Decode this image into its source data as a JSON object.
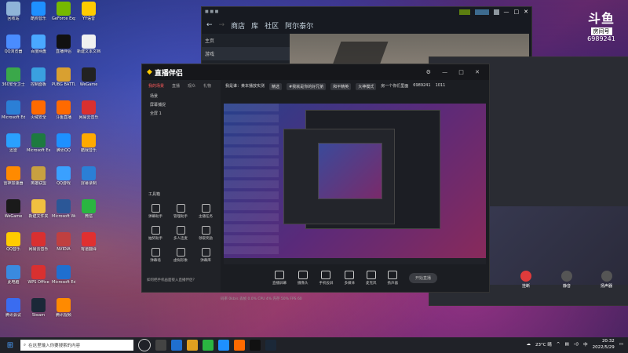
{
  "desktop_icons": [
    {
      "label": "回收站",
      "color": "#8fb4d8"
    },
    {
      "label": "QQ浏览器",
      "color": "#4a8cff"
    },
    {
      "label": "360安全卫士",
      "color": "#3aa84a"
    },
    {
      "label": "Microsoft Edge",
      "color": "#2b7fd6"
    },
    {
      "label": "迅雷",
      "color": "#2aa0ff"
    },
    {
      "label": "雷神加速器",
      "color": "#ff8a00"
    },
    {
      "label": "WeGame",
      "color": "#1a1a1a"
    },
    {
      "label": "QQ音乐",
      "color": "#ffcc00"
    },
    {
      "label": "此电脑",
      "color": "#3a8adf"
    },
    {
      "label": "腾讯会议",
      "color": "#3a6cf0"
    },
    {
      "label": "酷狗音乐",
      "color": "#1e90ff"
    },
    {
      "label": "百度网盘",
      "color": "#4aa8ff"
    },
    {
      "label": "控制面板",
      "color": "#3aa0e0"
    },
    {
      "label": "火绒安全",
      "color": "#ff6a00"
    },
    {
      "label": "Microsoft Excel 2010",
      "color": "#1d7a40"
    },
    {
      "label": "英雄联盟",
      "color": "#c8a040"
    },
    {
      "label": "新建文件夹",
      "color": "#f0c040"
    },
    {
      "label": "网易云音乐",
      "color": "#d93030"
    },
    {
      "label": "WPS Office",
      "color": "#d93030"
    },
    {
      "label": "Steam",
      "color": "#1b2838"
    },
    {
      "label": "GeForce Experience",
      "color": "#76b900"
    },
    {
      "label": "直播伴侣",
      "color": "#111"
    },
    {
      "label": "PUBG BATTLEGROUNDS",
      "color": "#d9a030"
    },
    {
      "label": "斗鱼直播",
      "color": "#ff6a00"
    },
    {
      "label": "腾讯QQ",
      "color": "#1e90ff"
    },
    {
      "label": "QQ游戏",
      "color": "#3aa0ff"
    },
    {
      "label": "Microsoft Word 2010",
      "color": "#2b5797"
    },
    {
      "label": "NVIDIA",
      "color": "#c04040"
    },
    {
      "label": "Microsoft Edge",
      "color": "#1f6fd0"
    },
    {
      "label": "腾讯视频",
      "color": "#ff8a00"
    },
    {
      "label": "YY语音",
      "color": "#ffcc00"
    },
    {
      "label": "新建文本文档",
      "color": "#f0f0f0"
    },
    {
      "label": "WeGame",
      "color": "#222"
    },
    {
      "label": "网易云音乐",
      "color": "#d93030"
    },
    {
      "label": "酷我音乐",
      "color": "#ffaa00"
    },
    {
      "label": "屏幕录制",
      "color": "#2b7fd6"
    },
    {
      "label": "微信",
      "color": "#2ab541"
    },
    {
      "label": "有道翻译",
      "color": "#e03030"
    }
  ],
  "steam": {
    "nav_back": "←",
    "nav_forward": "→",
    "tab_store": "商店",
    "tab_library": "库",
    "tab_community": "社区",
    "user_name": "阿尔泰尔",
    "side_items": [
      "主页",
      "游戏",
      "近期"
    ]
  },
  "brand": {
    "name": "斗鱼",
    "room_label": "房间号",
    "room_id": "6989241"
  },
  "obs": {
    "app_title": "直播伴侣",
    "tabs": [
      "我的场景",
      "直播",
      "观众",
      "礼物"
    ],
    "scene_items": [
      "场景",
      "屏幕捕捉",
      "全屏 1"
    ],
    "tools_title": "工具箱",
    "tools": [
      "弹幕助手",
      "管理助手",
      "主播任务",
      "抽奖助手",
      "多人连麦",
      "领取奖励",
      "弹幕墙",
      "虚拟形象",
      "弹幕库"
    ],
    "stream_title": "我是谁：黄本播放实测",
    "tag1": "精选",
    "tag2": "#我就是你的好兄弟",
    "category": "和平精英",
    "mode": "大神模式",
    "room_line": "房一个你们里面",
    "room_no": "6989241",
    "viewers": "1011",
    "bottom_buttons": [
      "直播屏幕",
      "摄像头",
      "手机投屏",
      "多媒体",
      "麦克风",
      "扬声器"
    ],
    "live_button": "开始直播",
    "hint": "如何把手机画面接入直播伴侣？",
    "status": "码率 0kb/s   丢帧 0.0%   CPU 4%   内存 50%   FPS 60"
  },
  "call": {
    "hangup_label": "挂断",
    "mute_label": "静音",
    "speaker_label": "扬声器"
  },
  "taskbar": {
    "search_placeholder": "在这里输入你要搜索的内容",
    "weather": "23°C 晴",
    "ime": "中",
    "time": "20:32",
    "date": "2022/5/29"
  }
}
